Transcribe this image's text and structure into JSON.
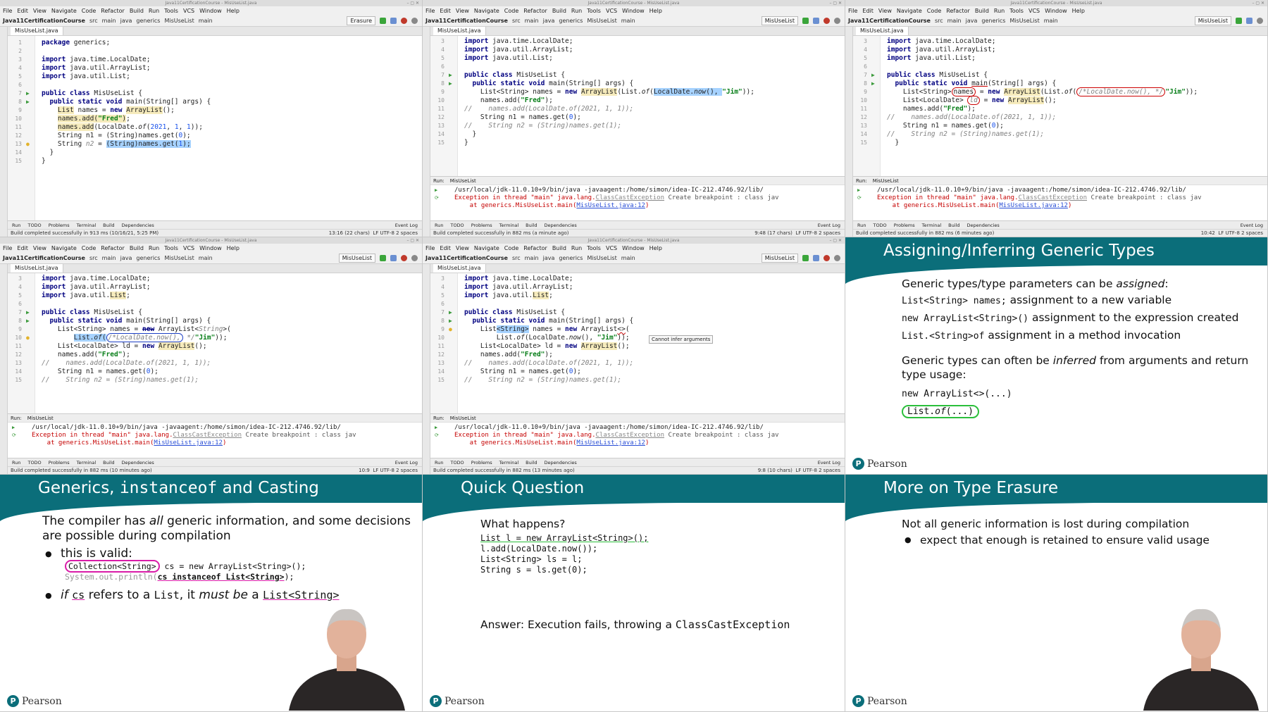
{
  "ide": {
    "menu": [
      "File",
      "Edit",
      "View",
      "Navigate",
      "Code",
      "Refactor",
      "Build",
      "Run",
      "Tools",
      "VCS",
      "Window",
      "Help"
    ],
    "menu_short": [
      "File",
      "Edit",
      "View",
      "Navigate",
      "Code",
      "Refactor",
      "Build",
      "Run",
      "Tools",
      "Window",
      "Help"
    ],
    "window_title": "Java11CertificationCourse - MisUseList.java",
    "project": "Java11CertificationCourse",
    "breadcrumb": [
      "src",
      "main",
      "java",
      "generics",
      "MisUseList",
      "main"
    ],
    "file_tab": "MisUseList.java",
    "run_tab_label": "Run:",
    "run_config_name": "MisUseList",
    "tool_tabs": [
      "Run",
      "TODO",
      "Problems",
      "Terminal",
      "Build",
      "Dependencies"
    ],
    "event_log": "Event Log",
    "run_cmd": "/usr/local/jdk-11.0.10+9/bin/java -javaagent:/home/simon/idea-IC-212.4746.92/lib/",
    "exc_prefix": "Exception in thread \"main\" java.lang.",
    "exc_class": "ClassCastException",
    "exc_suffix": " Create breakpoint : class jav",
    "stack_prefix": "    at generics.MisUseList.main(",
    "stack_link": "MisUseList.java:12",
    "stack_suffix": ")",
    "status_encoding": "LF  UTF-8  2 spaces"
  },
  "panels": {
    "p1": {
      "run_config": "Erasure",
      "status": "Build completed successfully in 913 ms (10/16/21, 5:25 PM)",
      "position": "13:16 (22 chars)",
      "code": [
        {
          "n": "1",
          "t": "package generics;"
        },
        {
          "n": "2",
          "t": ""
        },
        {
          "n": "3",
          "t": "import java.time.LocalDate;"
        },
        {
          "n": "4",
          "t": "import java.util.ArrayList;"
        },
        {
          "n": "5",
          "t": "import java.util.List;"
        },
        {
          "n": "6",
          "t": ""
        },
        {
          "n": "7",
          "t": "public class MisUseList {"
        },
        {
          "n": "8",
          "t": "  public static void main(String[] args) {"
        },
        {
          "n": "9",
          "t": "    List names = new ArrayList();"
        },
        {
          "n": "10",
          "t": "    names.add(\"Fred\");"
        },
        {
          "n": "11",
          "t": "    names.add(LocalDate.of(2021, 1, 1));"
        },
        {
          "n": "12",
          "t": "    String n1 = (String)names.get(0);"
        },
        {
          "n": "13",
          "t": "    String n2 = (String)names.get(1);"
        },
        {
          "n": "14",
          "t": "  }"
        },
        {
          "n": "15",
          "t": "}"
        }
      ]
    },
    "p2": {
      "run_config": "MisUseList",
      "status": "Build completed successfully in 882 ms (a minute ago)",
      "position": "9:48 (17 chars)",
      "code": [
        {
          "n": "3",
          "t": "import java.time.LocalDate;"
        },
        {
          "n": "4",
          "t": "import java.util.ArrayList;"
        },
        {
          "n": "5",
          "t": "import java.util.List;"
        },
        {
          "n": "6",
          "t": ""
        },
        {
          "n": "7",
          "t": "public class MisUseList {"
        },
        {
          "n": "8",
          "t": "  public static void main(String[] args) {"
        },
        {
          "n": "9",
          "t": "    List<String> names = new ArrayList(List.of(LocalDate.now(), \"Jim\"));"
        },
        {
          "n": "10",
          "t": "    names.add(\"Fred\");"
        },
        {
          "n": "11",
          "t": "//    names.add(LocalDate.of(2021, 1, 1));"
        },
        {
          "n": "12",
          "t": "    String n1 = names.get(0);"
        },
        {
          "n": "13",
          "t": "//    String n2 = (String)names.get(1);"
        },
        {
          "n": "14",
          "t": "  }"
        },
        {
          "n": "15",
          "t": "}"
        }
      ]
    },
    "p3": {
      "run_config": "MisUseList",
      "status": "Build completed successfully in 882 ms (6 minutes ago)",
      "position": "10:42",
      "code": [
        {
          "n": "3",
          "t": "import java.time.LocalDate;"
        },
        {
          "n": "4",
          "t": "import java.util.ArrayList;"
        },
        {
          "n": "5",
          "t": "import java.util.List;"
        },
        {
          "n": "6",
          "t": ""
        },
        {
          "n": "7",
          "t": "public class MisUseList {"
        },
        {
          "n": "8",
          "t": "  public static void main(String[] args) {"
        },
        {
          "n": "9",
          "t": "    List<String> names = new ArrayList(List.of(/*LocalDate.now(), */\"Jim\"));"
        },
        {
          "n": "10",
          "t": "    List<LocalDate> ld = new ArrayList();"
        },
        {
          "n": "11",
          "t": "    names.add(\"Fred\");"
        },
        {
          "n": "12",
          "t": "//    names.add(LocalDate.of(2021, 1, 1));"
        },
        {
          "n": "13",
          "t": "    String n1 = names.get(0);"
        },
        {
          "n": "14",
          "t": "//    String n2 = (String)names.get(1);"
        },
        {
          "n": "15",
          "t": "  }"
        }
      ]
    },
    "p4": {
      "run_config": "MisUseList",
      "status": "Build completed successfully in 882 ms (10 minutes ago)",
      "position": "10:9",
      "code": [
        {
          "n": "3",
          "t": "import java.time.LocalDate;"
        },
        {
          "n": "4",
          "t": "import java.util.ArrayList;"
        },
        {
          "n": "5",
          "t": "import java.util.List;"
        },
        {
          "n": "6",
          "t": ""
        },
        {
          "n": "7",
          "t": "public class MisUseList {"
        },
        {
          "n": "8",
          "t": "  public static void main(String[] args) {"
        },
        {
          "n": "9",
          "t": "    List<String> names = new ArrayList<String>("
        },
        {
          "n": "10",
          "t": "        List.of(/*LocalDate.now(), */\"Jim\"));"
        },
        {
          "n": "11",
          "t": "    List<LocalDate> ld = new ArrayList();"
        },
        {
          "n": "12",
          "t": "    names.add(\"Fred\");"
        },
        {
          "n": "13",
          "t": "//    names.add(LocalDate.of(2021, 1, 1));"
        },
        {
          "n": "14",
          "t": "    String n1 = names.get(0);"
        },
        {
          "n": "15",
          "t": "//    String n2 = (String)names.get(1);"
        }
      ]
    },
    "p5": {
      "run_config": "MisUseList",
      "status": "Build completed successfully in 882 ms (13 minutes ago)",
      "position": "9:8 (10 chars)",
      "tooltip": "Cannot infer arguments",
      "code": [
        {
          "n": "3",
          "t": "import java.time.LocalDate;"
        },
        {
          "n": "4",
          "t": "import java.util.ArrayList;"
        },
        {
          "n": "5",
          "t": "import java.util.List;"
        },
        {
          "n": "6",
          "t": ""
        },
        {
          "n": "7",
          "t": "public class MisUseList {"
        },
        {
          "n": "8",
          "t": "  public static void main(String[] args) {"
        },
        {
          "n": "9",
          "t": "    List<String> names = new ArrayList<>("
        },
        {
          "n": "10",
          "t": "        List.of(LocalDate.now(), \"Jim\"));"
        },
        {
          "n": "11",
          "t": "    List<LocalDate> ld = new ArrayList();"
        },
        {
          "n": "12",
          "t": "    names.add(\"Fred\");"
        },
        {
          "n": "13",
          "t": "//    names.add(LocalDate.of(2021, 1, 1));"
        },
        {
          "n": "14",
          "t": "    String n1 = names.get(0);"
        },
        {
          "n": "15",
          "t": "//    String n2 = (String)names.get(1);"
        }
      ]
    }
  },
  "slides": {
    "assign": {
      "title": "Assigning/Inferring Generic Types",
      "intro_pre": "Generic types/type parameters can be ",
      "intro_em": "assigned",
      "intro_post": ":",
      "rows": [
        {
          "code": "List<String> names;",
          "text": " assignment to a new variable"
        },
        {
          "code": "new ArrayList<String>()",
          "text": " assignment to the expression created"
        },
        {
          "code": "List.<String>of",
          "text": " assignment in a method invocation"
        }
      ],
      "infer_pre": "Generic types can often be ",
      "infer_em": "inferred",
      "infer_post": " from arguments and return type usage:",
      "infer_code1": "new ArrayList<>(...)",
      "infer_code2_pre": "List.",
      "infer_code2_em": "of",
      "infer_code2_post": "(...)"
    },
    "instanceof": {
      "title_pre": "Generics, ",
      "title_mono": "instanceof",
      "title_post": " and Casting",
      "para_pre": "The compiler has ",
      "para_em": "all",
      "para_post": " generic information, and some decisions are possible during compilation",
      "b1": "this is valid:",
      "code1a": "Collection<String>",
      "code1b": " cs = new ArrayList<String>();",
      "code2a": "System.out.println(",
      "code2b": "cs instanceof List<String>",
      "code2c": ");",
      "b2_if": "if",
      "b2_cs": "cs",
      "b2_mid": " refers to a ",
      "b2_list": "List",
      "b2_must": ", it ",
      "b2_mustbe": "must be",
      "b2_a": " a ",
      "b2_ls": "List<String>"
    },
    "question": {
      "title": "Quick Question",
      "q": "What happens?",
      "code": [
        "List l = new ArrayList<String>();",
        "l.add(LocalDate.now());",
        "List<String> ls = l;",
        "String s = ls.get(0);"
      ],
      "answer_pre": "Answer: Execution fails, throwing a ",
      "answer_code": "ClassCastException"
    },
    "erasure": {
      "title": "More on Type Erasure",
      "line": "Not all generic information is lost during compilation",
      "bullet": "expect that enough is retained to ensure valid usage"
    },
    "brand": "Pearson"
  },
  "colors": {
    "slide_header": "#0b6e7a",
    "annotation_green": "#2bbf3b",
    "annotation_magenta": "#d91ca8",
    "annotation_red": "#cc0000",
    "annotation_blue": "#1c3fc4"
  }
}
